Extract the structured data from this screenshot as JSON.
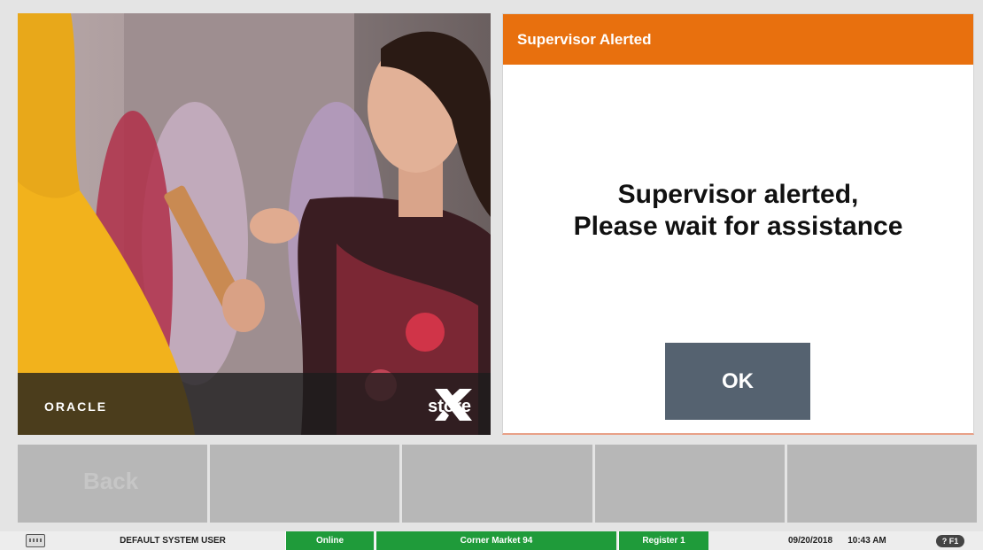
{
  "hero": {
    "oracle_logo": "ORACLE",
    "xstore_logo": "store"
  },
  "dialog": {
    "title": "Supervisor Alerted",
    "message_line1": "Supervisor alerted,",
    "message_line2": "Please wait for assistance",
    "ok_label": "OK"
  },
  "function_buttons": [
    "Back",
    "",
    "",
    "",
    ""
  ],
  "status_bar": {
    "user": "DEFAULT SYSTEM USER",
    "connection": "Online",
    "store": "Corner Market 94",
    "register": "Register 1",
    "date": "09/20/2018",
    "time": "10:43 AM",
    "help": "? F1"
  },
  "colors": {
    "header_orange": "#e8700e",
    "ok_button": "#556270",
    "status_green": "#1f9b3a"
  },
  "icons": [
    "keyboard-icon",
    "help-icon"
  ]
}
